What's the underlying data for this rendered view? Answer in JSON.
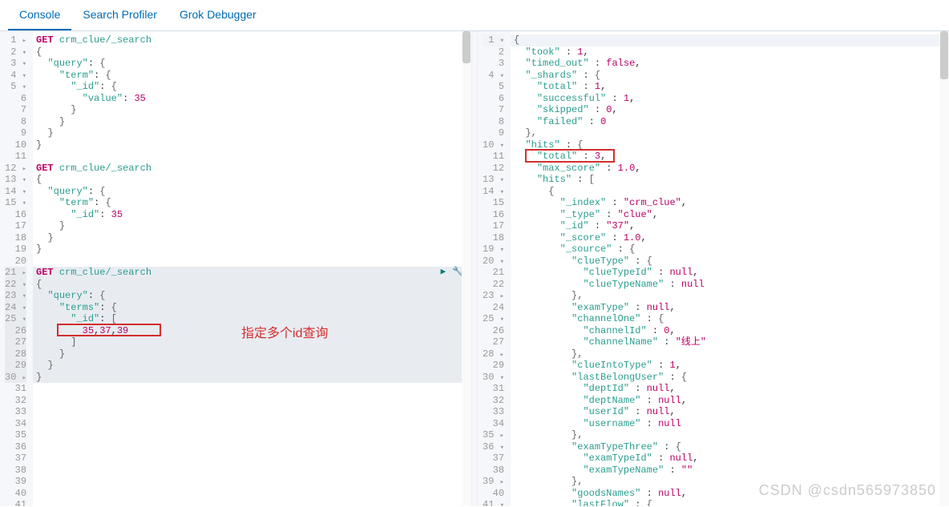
{
  "tabs": [
    {
      "label": "Console",
      "active": true
    },
    {
      "label": "Search Profiler",
      "active": false
    },
    {
      "label": "Grok Debugger",
      "active": false
    }
  ],
  "annotation": {
    "text": "指定多个id查询"
  },
  "watermark": "CSDN @csdn565973850",
  "leftEditor": {
    "maxLine": 41,
    "highlightStart": 21,
    "highlightEnd": 30,
    "redbox": {
      "line": 26,
      "text": "35,37,39"
    },
    "lines": [
      "<span class='method'>GET</span> <span class='path'>crm_clue/_search</span>",
      "<span class='punc'>{</span>",
      "  <span class='key'>\"query\"</span>: <span class='punc'>{</span>",
      "    <span class='key'>\"term\"</span>: <span class='punc'>{</span>",
      "      <span class='key'>\"_id\"</span>: <span class='punc'>{</span>",
      "        <span class='key'>\"value\"</span>: <span class='num'>35</span>",
      "      <span class='punc'>}</span>",
      "    <span class='punc'>}</span>",
      "  <span class='punc'>}</span>",
      "<span class='punc'>}</span>",
      "",
      "<span class='method'>GET</span> <span class='path'>crm_clue/_search</span>",
      "<span class='punc'>{</span>",
      "  <span class='key'>\"query\"</span>: <span class='punc'>{</span>",
      "    <span class='key'>\"term\"</span>: <span class='punc'>{</span>",
      "      <span class='key'>\"_id\"</span>: <span class='num'>35</span>",
      "    <span class='punc'>}</span>",
      "  <span class='punc'>}</span>",
      "<span class='punc'>}</span>",
      "",
      "<span class='method'>GET</span> <span class='path'>crm_clue/_search</span>",
      "<span class='punc'>{</span>",
      "  <span class='key'>\"query\"</span>: <span class='punc'>{</span>",
      "    <span class='key'>\"terms\"</span>: <span class='punc'>{</span>",
      "      <span class='key'>\"_id\"</span>: <span class='punc'>[</span>",
      "        <span class='num'>35</span>,<span class='num'>37</span>,<span class='num'>39</span>",
      "      <span class='punc'>]</span>",
      "    <span class='punc'>}</span>",
      "  <span class='punc'>}</span>",
      "<span class='punc'>}</span>",
      "",
      "",
      "",
      "",
      "",
      "",
      "",
      "",
      "",
      "",
      ""
    ],
    "arrows": {
      "1": "▸",
      "2": "▾",
      "3": "▾",
      "4": "▾",
      "5": "▾",
      "12": "▸",
      "13": "▾",
      "14": "▾",
      "15": "▾",
      "21": "▸",
      "22": "▾",
      "23": "▾",
      "24": "▾",
      "25": "▾",
      "30": "▸"
    }
  },
  "rightEditor": {
    "maxLine": 41,
    "activeRow": 1,
    "redbox": {
      "line": 11,
      "text": "\"total\" : 3,"
    },
    "lines": [
      "<span class='punc'>{</span>",
      "  <span class='key'>\"took\"</span> : <span class='num'>1</span>,",
      "  <span class='key'>\"timed_out\"</span> : <span class='null'>false</span>,",
      "  <span class='key'>\"_shards\"</span> : <span class='punc'>{</span>",
      "    <span class='key'>\"total\"</span> : <span class='num'>1</span>,",
      "    <span class='key'>\"successful\"</span> : <span class='num'>1</span>,",
      "    <span class='key'>\"skipped\"</span> : <span class='num'>0</span>,",
      "    <span class='key'>\"failed\"</span> : <span class='num'>0</span>",
      "  <span class='punc'>},</span>",
      "  <span class='key'>\"hits\"</span> : <span class='punc'>{</span>",
      "    <span class='key'>\"total\"</span> : <span class='num'>3</span>,",
      "    <span class='key'>\"max_score\"</span> : <span class='num'>1.0</span>,",
      "    <span class='key'>\"hits\"</span> : <span class='punc'>[</span>",
      "      <span class='punc'>{</span>",
      "        <span class='key'>\"_index\"</span> : <span class='strb'>\"crm_clue\"</span>,",
      "        <span class='key'>\"_type\"</span> : <span class='strb'>\"clue\"</span>,",
      "        <span class='key'>\"_id\"</span> : <span class='strb'>\"37\"</span>,",
      "        <span class='key'>\"_score\"</span> : <span class='num'>1.0</span>,",
      "        <span class='key'>\"_source\"</span> : <span class='punc'>{</span>",
      "          <span class='key'>\"clueType\"</span> : <span class='punc'>{</span>",
      "            <span class='key'>\"clueTypeId\"</span> : <span class='null'>null</span>,",
      "            <span class='key'>\"clueTypeName\"</span> : <span class='null'>null</span>",
      "          <span class='punc'>},</span>",
      "          <span class='key'>\"examType\"</span> : <span class='null'>null</span>,",
      "          <span class='key'>\"channelOne\"</span> : <span class='punc'>{</span>",
      "            <span class='key'>\"channelId\"</span> : <span class='num'>0</span>,",
      "            <span class='key'>\"channelName\"</span> : <span class='strb'>\"线上\"</span>",
      "          <span class='punc'>},</span>",
      "          <span class='key'>\"clueIntoType\"</span> : <span class='num'>1</span>,",
      "          <span class='key'>\"lastBelongUser\"</span> : <span class='punc'>{</span>",
      "            <span class='key'>\"deptId\"</span> : <span class='null'>null</span>,",
      "            <span class='key'>\"deptName\"</span> : <span class='null'>null</span>,",
      "            <span class='key'>\"userId\"</span> : <span class='null'>null</span>,",
      "            <span class='key'>\"username\"</span> : <span class='null'>null</span>",
      "          <span class='punc'>},</span>",
      "          <span class='key'>\"examTypeThree\"</span> : <span class='punc'>{</span>",
      "            <span class='key'>\"examTypeId\"</span> : <span class='null'>null</span>,",
      "            <span class='key'>\"examTypeName\"</span> : <span class='strb'>\"\"</span>",
      "          <span class='punc'>},</span>",
      "          <span class='key'>\"goodsNames\"</span> : <span class='null'>null</span>,",
      "          <span class='key'>\"lastFlow\"</span> : <span class='punc'>{</span>"
    ],
    "arrows": {
      "1": "▾",
      "4": "▾",
      "10": "▾",
      "13": "▾",
      "14": "▾",
      "19": "▾",
      "20": "▾",
      "23": "▸",
      "25": "▾",
      "28": "▸",
      "30": "▾",
      "35": "▸",
      "36": "▾",
      "39": "▸",
      "41": "▾"
    }
  }
}
